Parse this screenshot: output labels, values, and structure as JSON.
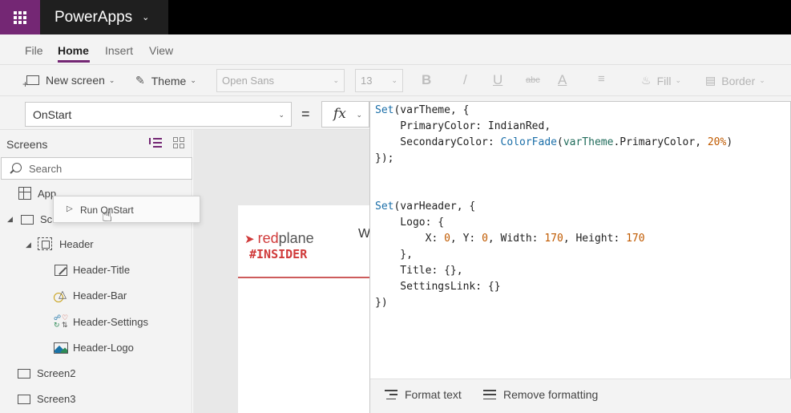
{
  "app": {
    "title": "PowerApps"
  },
  "menu": {
    "tabs": [
      "File",
      "Home",
      "Insert",
      "View"
    ],
    "active": "Home"
  },
  "ribbon": {
    "new_screen": "New screen",
    "theme": "Theme",
    "font": "Open Sans",
    "font_size": "13",
    "bold": "B",
    "italic": "/",
    "underline": "U",
    "strike": "abc",
    "font_color": "A",
    "fill": "Fill",
    "border": "Border"
  },
  "formula": {
    "property": "OnStart",
    "equals": "=",
    "fx": "fx"
  },
  "tree": {
    "title": "Screens",
    "search_placeholder": "Search",
    "items": {
      "app": "App",
      "screen1": "Scr",
      "header": "Header",
      "header_title": "Header-Title",
      "header_bar": "Header-Bar",
      "header_settings": "Header-Settings",
      "header_logo": "Header-Logo",
      "screen2": "Screen2",
      "screen3": "Screen3"
    }
  },
  "context_menu": {
    "run_onstart": "Run OnStart"
  },
  "canvas": {
    "logo_part1": "red",
    "logo_part2": "plane",
    "logo_tag": "#INSIDER",
    "partial_title": "W"
  },
  "editor": {
    "footer": {
      "format_text": "Format text",
      "remove_formatting": "Remove formatting"
    }
  },
  "colors": {
    "brand": "#742774",
    "accent_red": "#cd5c5c",
    "topbar": "#000000"
  }
}
